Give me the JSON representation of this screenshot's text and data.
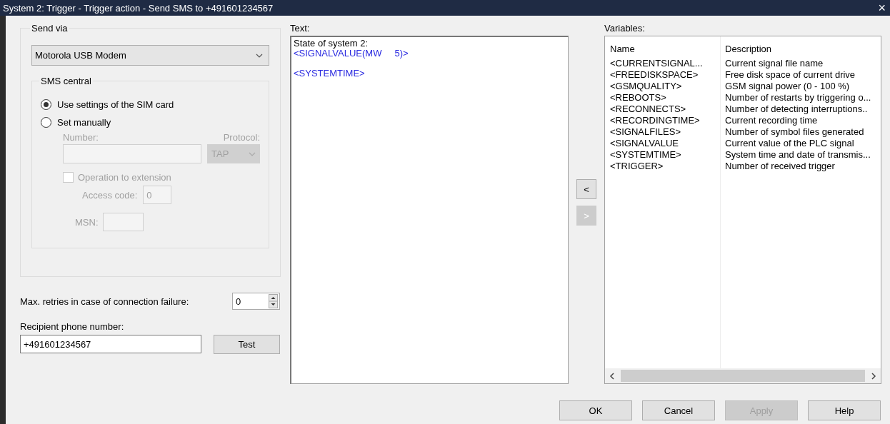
{
  "window": {
    "title": "System 2: Trigger - Trigger action - Send SMS to +491601234567",
    "close": "×"
  },
  "send_via": {
    "title": "Send via",
    "device": "Motorola USB Modem",
    "sms_central": {
      "title": "SMS central",
      "disabled_fields": true,
      "options": [
        {
          "label": "Use settings of the SIM card",
          "selected": true
        },
        {
          "label": "Set manually",
          "selected": false
        }
      ],
      "number_label": "Number:",
      "protocol_label": "Protocol:",
      "protocol": "TAP",
      "extension": {
        "label": "Operation to extension",
        "checked": false
      },
      "access_code_label": "Access code:",
      "access_code": "0",
      "msn_label": "MSN:"
    }
  },
  "max_retries": {
    "label": "Max. retries in case of connection failure:",
    "value": "0"
  },
  "recipient": {
    "label": "Recipient phone number:",
    "value": "+491601234567",
    "test_button": "Test"
  },
  "text_editor": {
    "label": "Text:",
    "lines": [
      {
        "text": "State of system 2:",
        "kind": "plain",
        "blank_before": false
      },
      {
        "text": "<SIGNALVALUE(MW     5)>",
        "kind": "variable",
        "blank_before": false
      },
      {
        "text": "<SYSTEMTIME>",
        "kind": "variable",
        "blank_before": true
      }
    ]
  },
  "move_buttons": [
    {
      "label": "<",
      "disabled": false
    },
    {
      "label": ">",
      "disabled": true
    }
  ],
  "variables": {
    "label": "Variables:",
    "columns": [
      "Name",
      "Description"
    ],
    "rows": [
      {
        "name": "<CURRENTSIGNAL...",
        "description": "Current signal file name"
      },
      {
        "name": "<FREEDISKSPACE>",
        "description": "Free disk space of current drive"
      },
      {
        "name": "<GSMQUALITY>",
        "description": "GSM signal power (0 - 100 %)"
      },
      {
        "name": "<REBOOTS>",
        "description": "Number of restarts by triggering o..."
      },
      {
        "name": "<RECONNECTS>",
        "description": "Number of detecting interruptions.."
      },
      {
        "name": "<RECORDINGTIME>",
        "description": "Current recording time"
      },
      {
        "name": "<SIGNALFILES>",
        "description": "Number of symbol files generated"
      },
      {
        "name": "<SIGNALVALUE",
        "description": "Current value of the PLC signal"
      },
      {
        "name": "<SYSTEMTIME>",
        "description": "System time and date of transmis..."
      },
      {
        "name": "<TRIGGER>",
        "description": "Number of received trigger"
      }
    ]
  },
  "buttons": [
    {
      "label": "OK",
      "disabled": false
    },
    {
      "label": "Cancel",
      "disabled": false
    },
    {
      "label": "Apply",
      "disabled": true
    },
    {
      "label": "Help",
      "disabled": false
    }
  ]
}
